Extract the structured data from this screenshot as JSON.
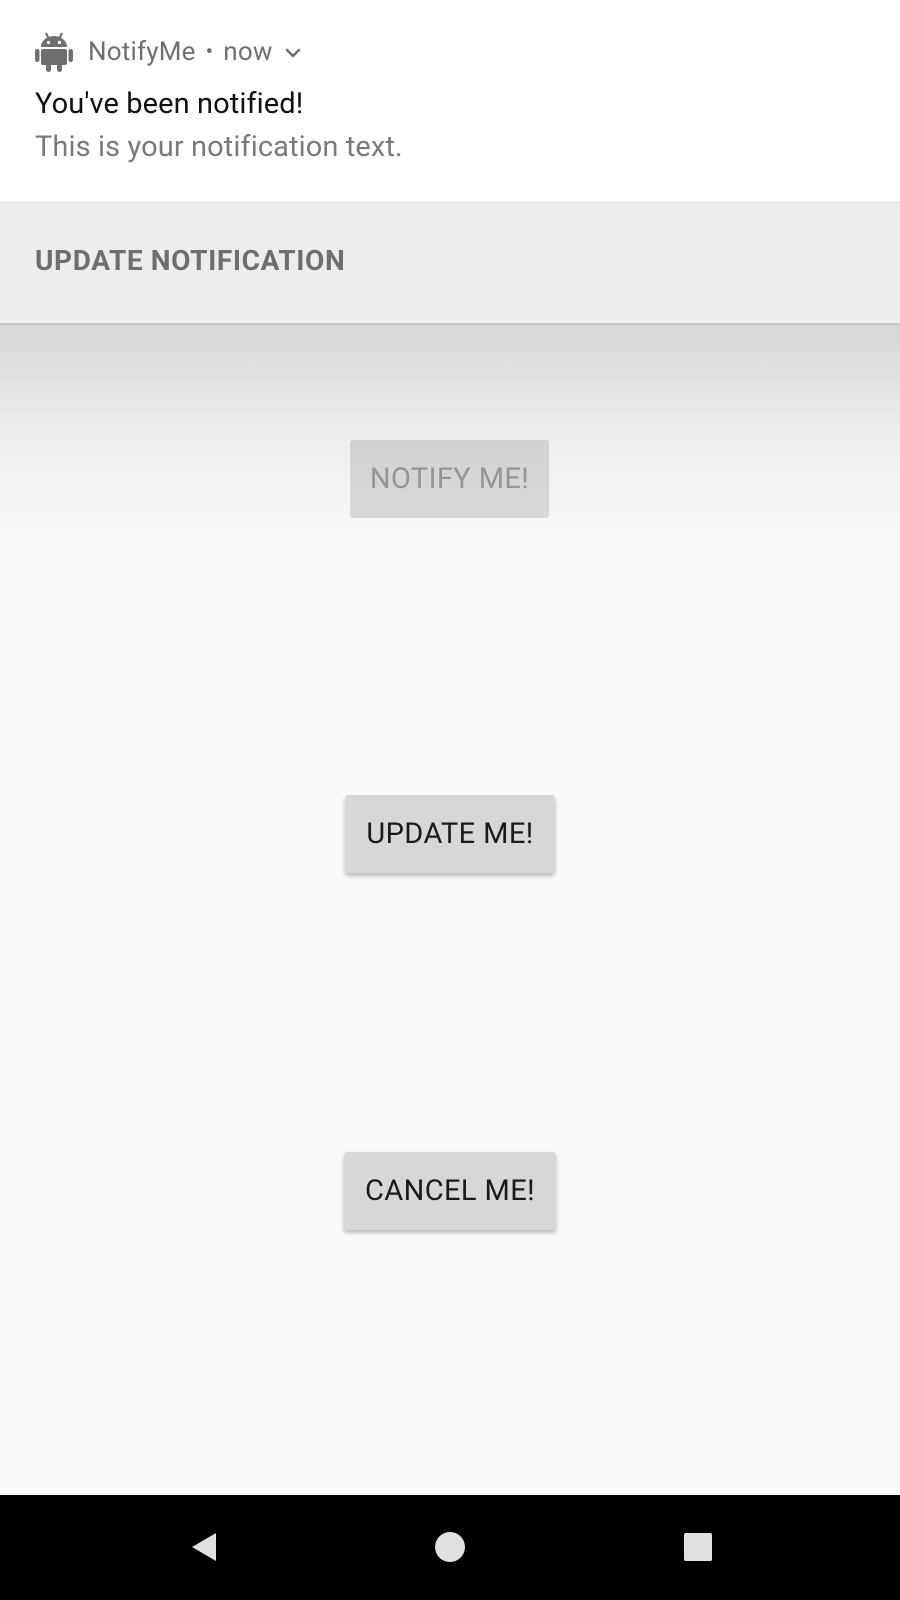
{
  "notification": {
    "app_name": "NotifyMe",
    "separator": "•",
    "time": "now",
    "title": "You've been notified!",
    "text": "This is your notification text.",
    "action_label": "UPDATE NOTIFICATION",
    "icons": {
      "app": "android-icon",
      "expand": "chevron-down-icon"
    }
  },
  "buttons": {
    "notify_label": "NOTIFY ME!",
    "update_label": "UPDATE ME!",
    "cancel_label": "CANCEL ME!"
  },
  "nav": {
    "icons": [
      "back-icon",
      "home-icon",
      "recents-icon"
    ]
  },
  "colors": {
    "nav_bar": "#000000",
    "button_bg": "#d6d7d7",
    "action_bar_bg": "#ededed",
    "page_bg": "#fafafa"
  }
}
